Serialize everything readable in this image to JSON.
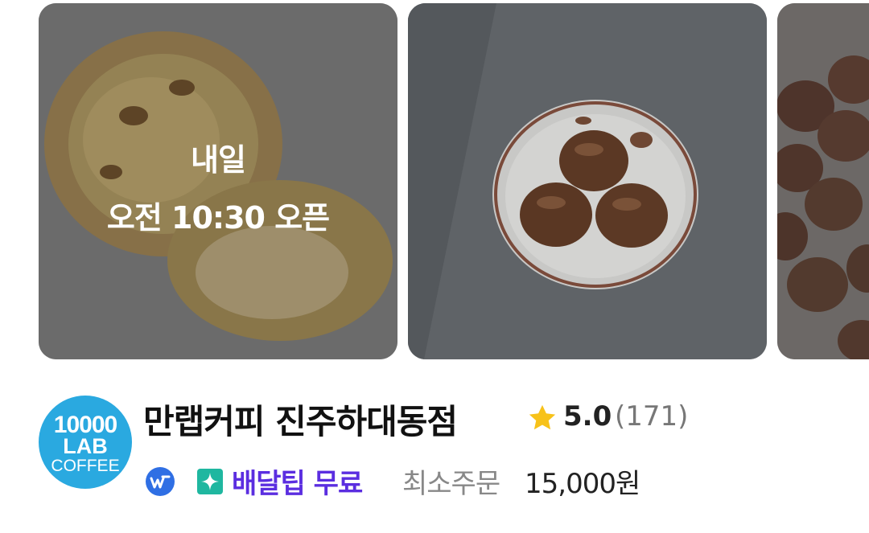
{
  "cards": [
    {
      "overlay_line1": "내일",
      "overlay_line2": "오전 10:30 오픈",
      "icon": "egg-tart-photo"
    },
    {
      "icon": "chestnut-pastry-photo"
    },
    {
      "icon": "chocolate-dome-photo"
    }
  ],
  "store": {
    "logo": {
      "line1": "10000",
      "line2": "LAB",
      "line3": "COFFEE"
    },
    "name": "만랩커피 진주하대동점",
    "rating": "5.0",
    "review_count": "(171)",
    "delivery_icon": "delivery-badge-icon",
    "tip_icon": "sparkle-icon",
    "tip_label": "배달팁 무료",
    "min_order_label": "최소주문",
    "min_order_value": "15,000원"
  },
  "colors": {
    "tip": "#5b2ee0",
    "star": "#f7c21a",
    "logo": "#2aa9e0"
  }
}
